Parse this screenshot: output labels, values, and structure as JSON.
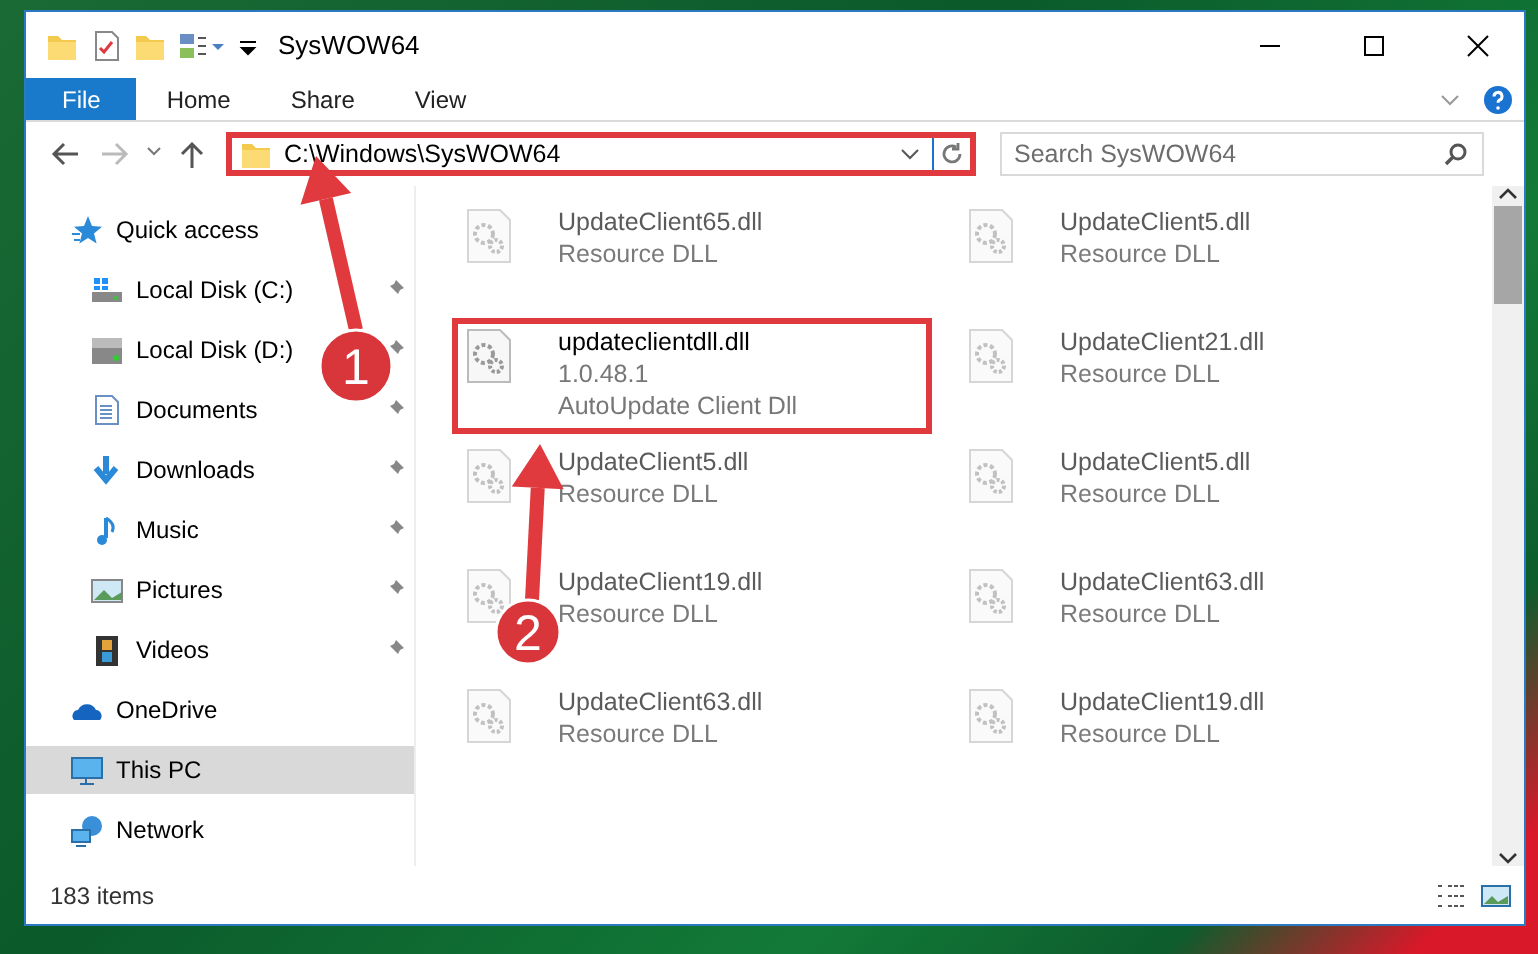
{
  "window": {
    "title": "SysWOW64"
  },
  "ribbon_tabs": [
    {
      "label": "File",
      "selected": true
    },
    {
      "label": "Home",
      "selected": false
    },
    {
      "label": "Share",
      "selected": false
    },
    {
      "label": "View",
      "selected": false
    }
  ],
  "address_bar": {
    "path": "C:\\Windows\\SysWOW64",
    "highlighted": true
  },
  "search": {
    "placeholder": "Search SysWOW64"
  },
  "navigation": [
    {
      "label": "Quick access",
      "selected": false,
      "children": [
        {
          "label": "Local Disk (C:)",
          "pinned": true
        },
        {
          "label": "Local Disk (D:)",
          "pinned": true
        },
        {
          "label": "Documents",
          "pinned": true
        },
        {
          "label": "Downloads",
          "pinned": true
        },
        {
          "label": "Music",
          "pinned": true
        },
        {
          "label": "Pictures",
          "pinned": true
        },
        {
          "label": "Videos",
          "pinned": true
        }
      ]
    },
    {
      "label": "OneDrive",
      "selected": false
    },
    {
      "label": "This PC",
      "selected": true
    },
    {
      "label": "Network",
      "selected": false
    }
  ],
  "files": [
    {
      "name": "UpdateClient65.dll",
      "details": [
        "Resource DLL"
      ],
      "blurred": true,
      "highlighted": false
    },
    {
      "name": "UpdateClient5.dll",
      "details": [
        "Resource DLL"
      ],
      "blurred": true,
      "highlighted": false
    },
    {
      "name": "updateclientdll.dll",
      "details": [
        "1.0.48.1",
        "AutoUpdate Client Dll"
      ],
      "blurred": false,
      "highlighted": true
    },
    {
      "name": "UpdateClient21.dll",
      "details": [
        "Resource DLL"
      ],
      "blurred": true,
      "highlighted": false
    },
    {
      "name": "UpdateClient5.dll",
      "details": [
        "Resource DLL"
      ],
      "blurred": true,
      "highlighted": false
    },
    {
      "name": "UpdateClient5.dll",
      "details": [
        "Resource DLL"
      ],
      "blurred": true,
      "highlighted": false
    },
    {
      "name": "UpdateClient19.dll",
      "details": [
        "Resource DLL"
      ],
      "blurred": true,
      "highlighted": false
    },
    {
      "name": "UpdateClient63.dll",
      "details": [
        "Resource DLL"
      ],
      "blurred": true,
      "highlighted": false
    },
    {
      "name": "UpdateClient63.dll",
      "details": [
        "Resource DLL"
      ],
      "blurred": true,
      "highlighted": false
    },
    {
      "name": "UpdateClient19.dll",
      "details": [
        "Resource DLL"
      ],
      "blurred": true,
      "highlighted": false
    }
  ],
  "status_bar": {
    "item_count": "183 items"
  },
  "annotations": [
    {
      "label": "1"
    },
    {
      "label": "2"
    }
  ]
}
